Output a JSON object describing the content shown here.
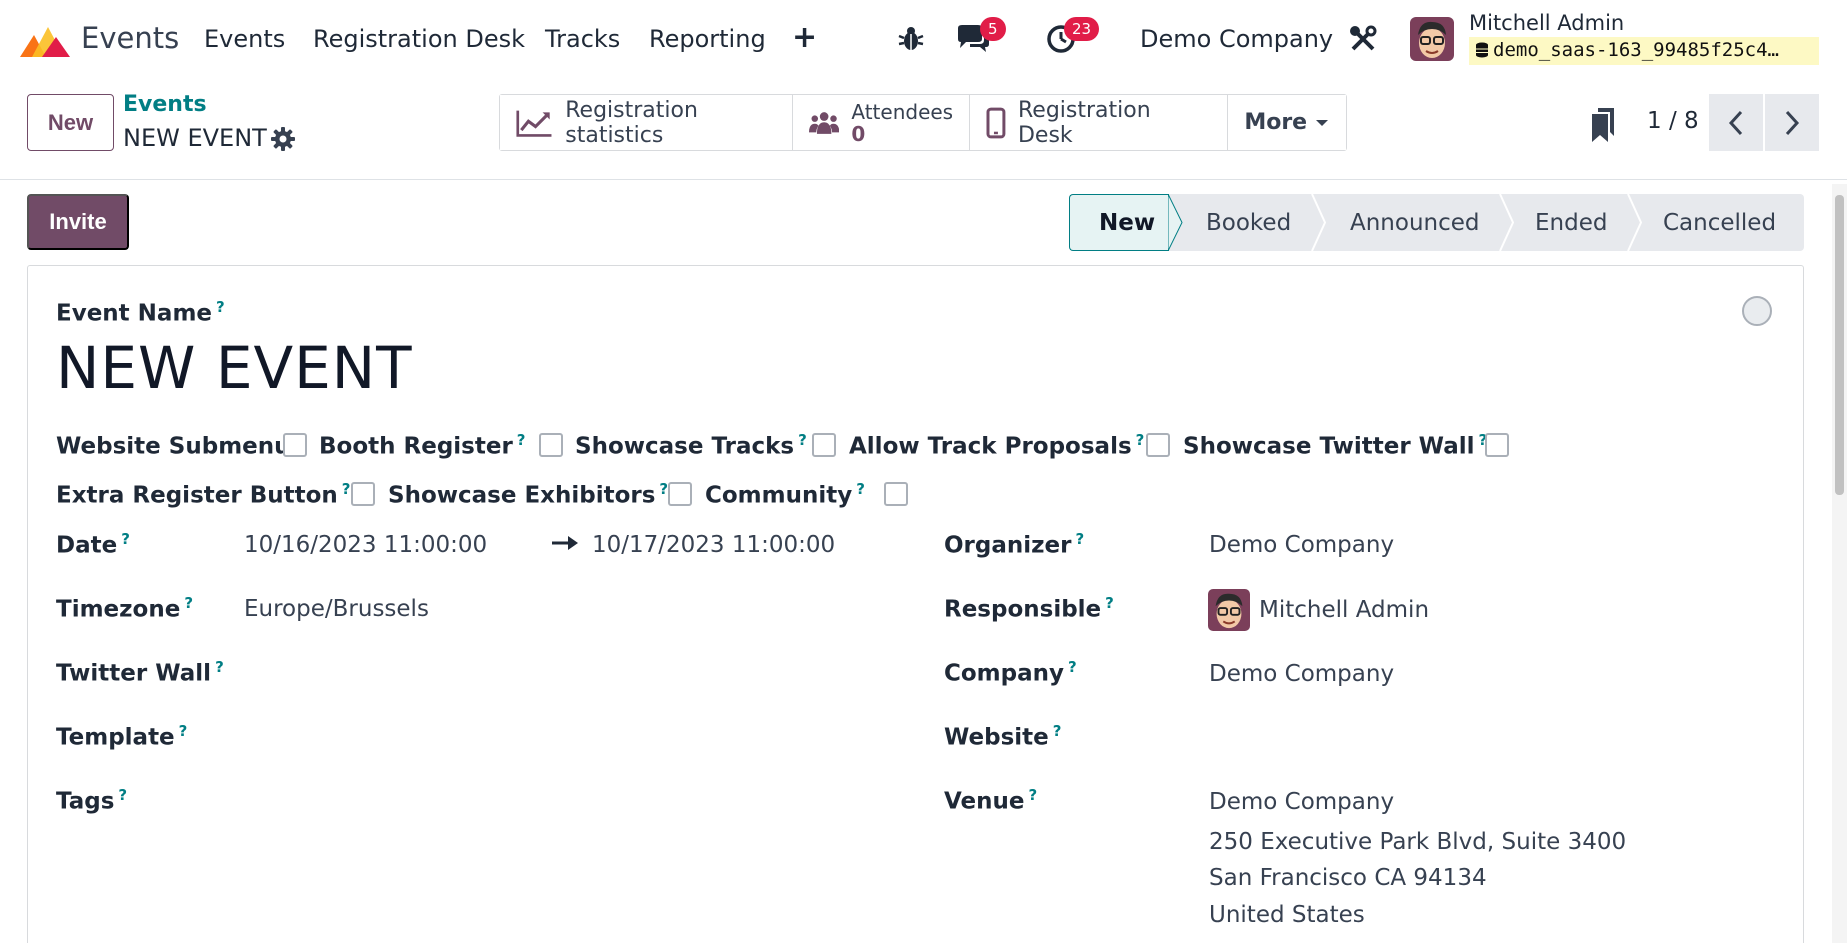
{
  "navbar": {
    "app_name": "Events",
    "menu": [
      "Events",
      "Registration Desk",
      "Tracks",
      "Reporting"
    ],
    "plus_label": "+",
    "messages_badge": "5",
    "activities_badge": "23",
    "company": "Demo Company",
    "user_name": "Mitchell Admin",
    "database": "demo_saas-163_99485f25c4…"
  },
  "control": {
    "new_label": "New",
    "breadcrumb_parent": "Events",
    "breadcrumb_current": "NEW EVENT",
    "smart_buttons": {
      "stats": "Registration statistics",
      "attendees_label": "Attendees",
      "attendees_count": "0",
      "desk": "Registration Desk",
      "more": "More"
    },
    "pager": "1 / 8"
  },
  "status": {
    "invite_label": "Invite",
    "stages": [
      "New",
      "Booked",
      "Announced",
      "Ended",
      "Cancelled"
    ],
    "active_stage": "New"
  },
  "form": {
    "event_name_label": "Event Name",
    "event_name": "NEW EVENT",
    "help_mark": "?",
    "checkboxes": [
      {
        "label": "Website Submenu",
        "checked": false
      },
      {
        "label": "Booth Register",
        "checked": false
      },
      {
        "label": "Showcase Tracks",
        "checked": false
      },
      {
        "label": "Allow Track Proposals",
        "checked": false
      },
      {
        "label": "Showcase Twitter Wall",
        "checked": false
      },
      {
        "label": "Extra Register Button",
        "checked": false
      },
      {
        "label": "Showcase Exhibitors",
        "checked": false
      },
      {
        "label": "Community",
        "checked": false
      }
    ],
    "left": {
      "date_label": "Date",
      "date_start": "10/16/2023 11:00:00",
      "date_end": "10/17/2023 11:00:00",
      "timezone_label": "Timezone",
      "timezone": "Europe/Brussels",
      "twitter_label": "Twitter Wall",
      "template_label": "Template",
      "tags_label": "Tags"
    },
    "right": {
      "organizer_label": "Organizer",
      "organizer": "Demo Company",
      "responsible_label": "Responsible",
      "responsible": "Mitchell Admin",
      "company_label": "Company",
      "company": "Demo Company",
      "website_label": "Website",
      "venue_label": "Venue",
      "venue_lines": [
        "Demo Company",
        "250 Executive Park Blvd, Suite 3400",
        "San Francisco CA 94134",
        "United States"
      ]
    }
  },
  "colors": {
    "brand": "#714b67",
    "accent": "#017e84",
    "badge": "#e11d48"
  }
}
